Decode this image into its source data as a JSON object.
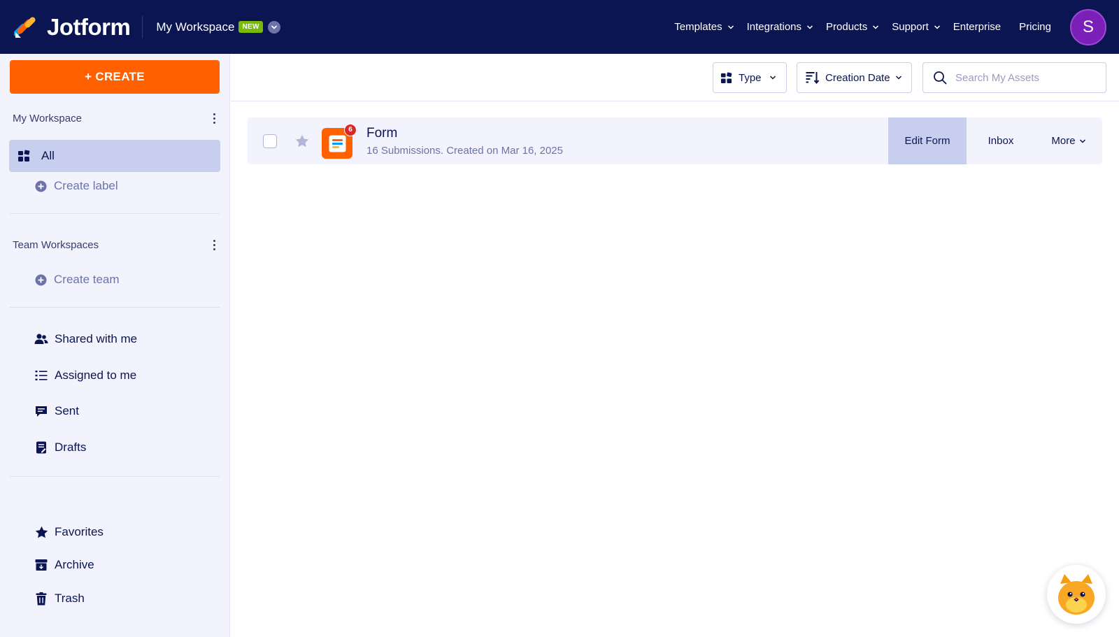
{
  "header": {
    "logo_text": "Jotform",
    "workspace_title": "My Workspace",
    "new_badge": "NEW",
    "nav": [
      {
        "label": "Templates"
      },
      {
        "label": "Integrations"
      },
      {
        "label": "Products"
      },
      {
        "label": "Support"
      },
      {
        "label": "Enterprise"
      },
      {
        "label": "Pricing"
      }
    ],
    "avatar_initial": "S"
  },
  "sidebar": {
    "create_label": "+ CREATE",
    "my_workspace_header": "My Workspace",
    "all_label": "All",
    "create_label_link": "Create label",
    "team_workspaces_header": "Team Workspaces",
    "create_team_link": "Create team",
    "items": [
      {
        "label": "Shared with me",
        "icon": "shared-users-icon"
      },
      {
        "label": "Assigned to me",
        "icon": "assigned-list-icon"
      },
      {
        "label": "Sent",
        "icon": "sent-message-icon"
      },
      {
        "label": "Drafts",
        "icon": "drafts-icon"
      },
      {
        "label": "Favorites",
        "icon": "star-icon"
      },
      {
        "label": "Archive",
        "icon": "archive-icon"
      },
      {
        "label": "Trash",
        "icon": "trash-icon"
      }
    ]
  },
  "toolbar": {
    "type_label": "Type",
    "sort_label": "Creation Date",
    "search_placeholder": "Search My Assets"
  },
  "forms": [
    {
      "title": "Form",
      "meta": "16 Submissions. Created on Mar 16, 2025",
      "badge_count": "6",
      "actions": {
        "edit": "Edit Form",
        "inbox": "Inbox",
        "more": "More"
      }
    }
  ],
  "colors": {
    "navy": "#0a1551",
    "orange": "#ff6100",
    "sidebar_bg": "#f3f3fe",
    "selected_bg": "#c8ceed",
    "avatar_purple": "#7c1fb8",
    "badge_green": "#78bb07"
  }
}
